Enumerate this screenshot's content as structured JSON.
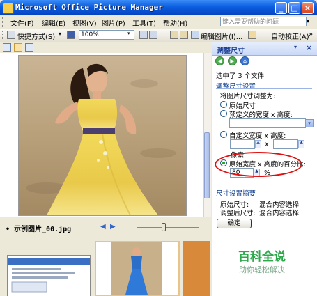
{
  "window": {
    "title": "Microsoft Office Picture Manager",
    "controls": {
      "minimize": "_",
      "maximize": "□",
      "close": "×"
    }
  },
  "menu": {
    "items": [
      "文件(F)",
      "编辑(E)",
      "视图(V)",
      "图片(P)",
      "工具(T)",
      "帮助(H)"
    ],
    "help_placeholder": "键入需要帮助的问题",
    "help_dropdown": "▾"
  },
  "toolbar": {
    "shortcut_label": "快捷方式(S)",
    "shortcut_dropdown": "▾",
    "zoom_value": "100%",
    "edit_picture_label": "编辑图片(I)...",
    "auto_correct_label": "自动校正(A)",
    "more": "»"
  },
  "status": {
    "filename": "• 示例图片_00.jpg",
    "prev": "◀",
    "next": "▶"
  },
  "pane": {
    "title": "调整尺寸",
    "dropdown": "▾",
    "close": "×",
    "selected_text": "选中了 3 个文件",
    "section_settings": "调整尺寸设置",
    "resize_label": "将图片尺寸调整为:",
    "opt_original": "原始尺寸",
    "opt_predefined": "预定义的宽度 x 高度:",
    "opt_custom": "自定义宽度 x 高度:",
    "x_sep": "x",
    "pixel_label": "像素",
    "opt_percent": "原始宽度 x 高度的百分比:",
    "percent_value": "80",
    "percent_unit": "%",
    "section_summary": "尺寸设置摘要",
    "original_size_label": "原始尺寸:",
    "original_size_value": "混合内容选择",
    "adjusted_size_label": "调整后尺寸:",
    "adjusted_size_value": "混合内容选择",
    "ok_label": "确定",
    "selected_option": "percent"
  },
  "watermark": {
    "title": "百科全说",
    "subtitle": "助你轻松解决"
  },
  "icons": {
    "nav_back": "◀",
    "nav_forward": "▶",
    "nav_home": "⌂",
    "spin_up": "▲",
    "spin_down": "▼",
    "dropdown": "▾"
  },
  "colors": {
    "titlebar": "#0a5ee0",
    "pane_title": "#1c3f94",
    "annotation": "#e01010",
    "watermark": "#2aa84a"
  }
}
